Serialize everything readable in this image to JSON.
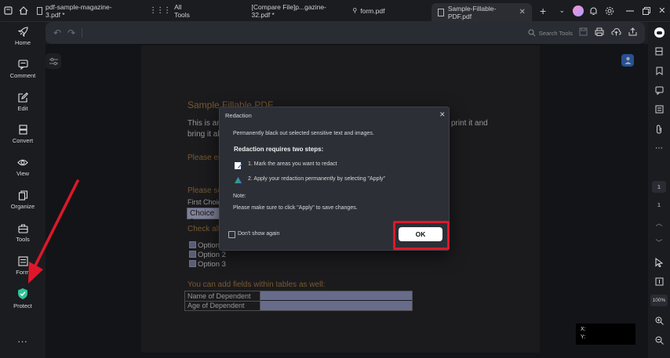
{
  "tabs": [
    {
      "label": "pdf-sample-magazine-3.pdf *"
    },
    {
      "label": "All Tools"
    },
    {
      "label": "[Compare  File]p...gazine-32.pdf *"
    },
    {
      "label": "form.pdf"
    },
    {
      "label": "Sample-Fillable-PDF.pdf"
    }
  ],
  "sidebar": {
    "items": [
      {
        "label": "Home"
      },
      {
        "label": "Comment"
      },
      {
        "label": "Edit"
      },
      {
        "label": "Convert"
      },
      {
        "label": "View"
      },
      {
        "label": "Organize"
      },
      {
        "label": "Tools"
      },
      {
        "label": "Form"
      },
      {
        "label": "Protect"
      }
    ],
    "more": "..."
  },
  "toolbar": {
    "search_label": "Search Tools"
  },
  "pdf": {
    "title": "Sample Fillable PDF",
    "line1_start": "This is an e",
    "line1_end": "print it and",
    "line2": "bring it alo",
    "please_enter": "Please en",
    "please_select": "Please se",
    "first_choice": "First Choic",
    "choice_value": "Choice 1",
    "check_all": "Check all",
    "options": [
      "Option 1",
      "Option 2",
      "Option 3"
    ],
    "tables_note": "You can add  fields within tables as well:",
    "row1": "Name of Dependent",
    "row2": "Age of Dependent"
  },
  "dialog": {
    "title": "Redaction",
    "desc": "Permanently black out selected sensitive text and images.",
    "steps_heading": "Redaction requires two steps:",
    "step1": "1. Mark the areas you want to redact",
    "step2": "2. Apply your redaction permanently by selecting \"Apply\"",
    "note_label": "Note:",
    "note_text": "Please make sure to click \"Apply\" to save changes.",
    "dont_show": "Don't show again",
    "ok": "OK"
  },
  "rightbar": {
    "page_current": "1",
    "page_total": "1",
    "zoom": "100%"
  },
  "coords": {
    "x_label": "X:",
    "y_label": "Y:"
  },
  "colors": {
    "highlight": "#e0172a",
    "accent": "#b8884a",
    "field": "#a0a6d6"
  }
}
